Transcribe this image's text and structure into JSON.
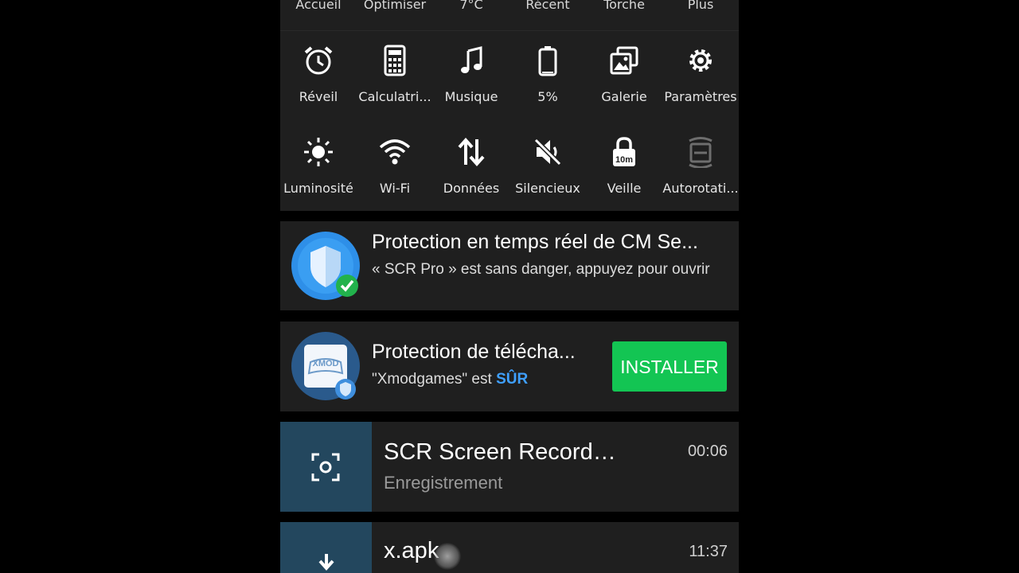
{
  "top_row": [
    "Accueil",
    "Optimiser",
    "7°C",
    "Récent",
    "Torche",
    "Plus"
  ],
  "tiles_row1": [
    {
      "label": "Réveil",
      "icon": "alarm-clock-icon"
    },
    {
      "label": "Calculatri...",
      "icon": "calculator-icon"
    },
    {
      "label": "Musique",
      "icon": "music-note-icon"
    },
    {
      "label": "5%",
      "icon": "battery-icon"
    },
    {
      "label": "Galerie",
      "icon": "gallery-icon"
    },
    {
      "label": "Paramètres",
      "icon": "gear-icon"
    }
  ],
  "tiles_row2": [
    {
      "label": "Luminosité",
      "icon": "brightness-icon"
    },
    {
      "label": "Wi-Fi",
      "icon": "wifi-icon"
    },
    {
      "label": "Données",
      "icon": "data-arrows-icon"
    },
    {
      "label": "Silencieux",
      "icon": "mute-icon"
    },
    {
      "label": "Veille",
      "icon": "sleep-lock-icon",
      "badge": "10m"
    },
    {
      "label": "Autorotati...",
      "icon": "autorotate-icon"
    }
  ],
  "notifications": {
    "cm_security": {
      "title": "Protection en temps réel de CM Se...",
      "body": "« SCR Pro » est sans danger, appuyez pour ouvrir"
    },
    "download_protection": {
      "title": "Protection de télécha...",
      "body_prefix": "\"Xmodgames\" est ",
      "body_status": "SÛR",
      "button": "INSTALLER",
      "app_icon_text": "XMOD"
    },
    "screen_recorder": {
      "title": "SCR Screen Recorder Pro",
      "status": "Enregistrement",
      "time": "00:06"
    },
    "download": {
      "title": "x.apk",
      "time": "11:37"
    }
  },
  "colors": {
    "panel": "#1f1f1f",
    "install_green": "#13c553",
    "safe_blue": "#3fa0ff",
    "recorder_box": "#23475e"
  }
}
